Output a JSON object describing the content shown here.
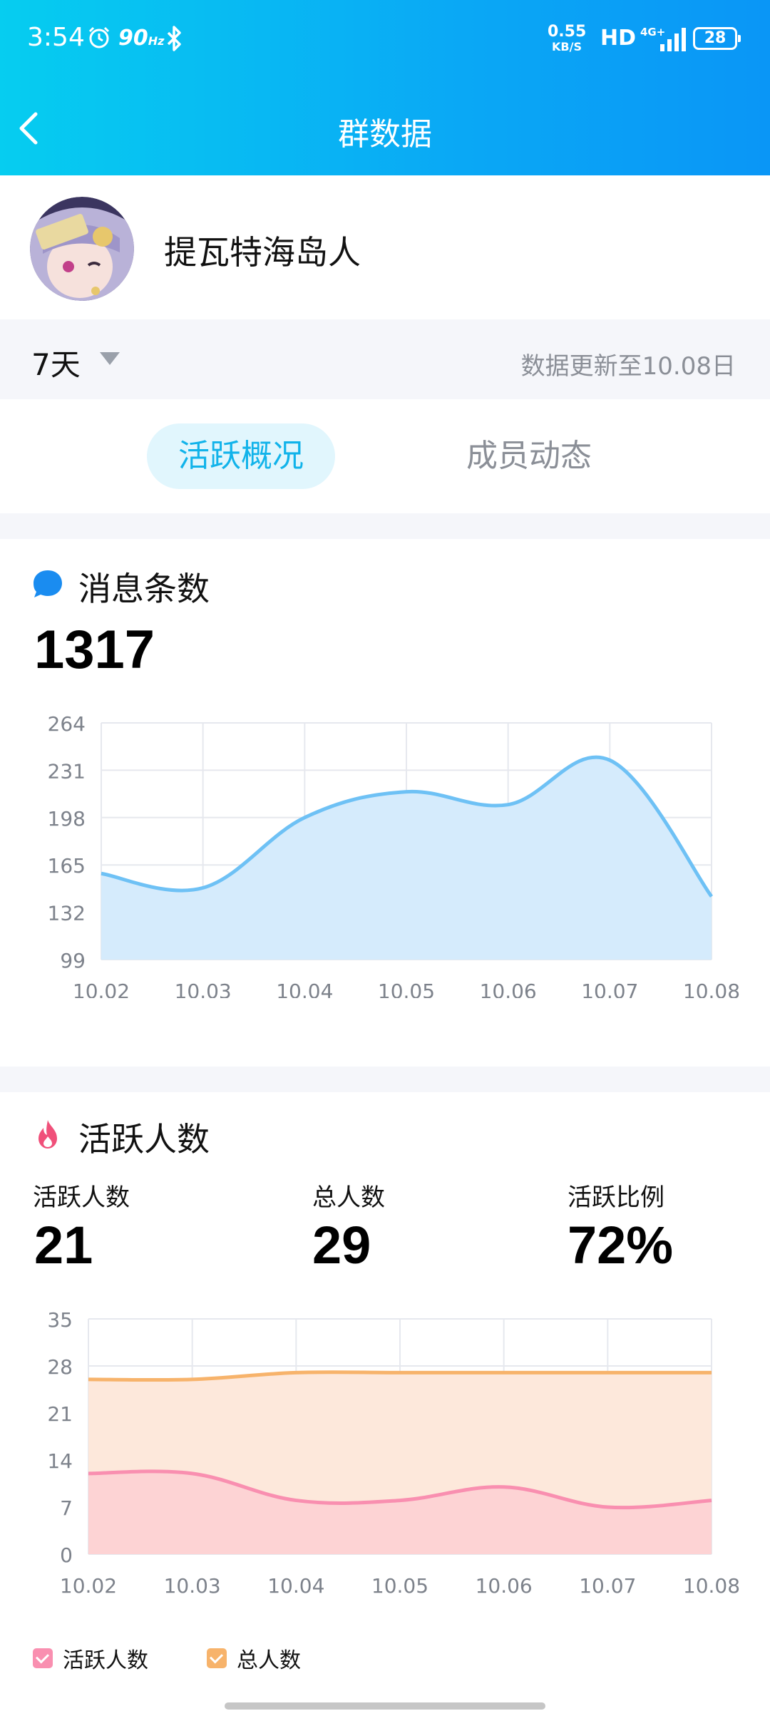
{
  "status_bar": {
    "time": "3:54",
    "refresh_rate": "90",
    "refresh_unit": "Hz",
    "net_speed_value": "0.55",
    "net_speed_unit": "KB/S",
    "hd_label": "HD",
    "network_label": "4G+",
    "battery": "28"
  },
  "nav": {
    "title": "群数据"
  },
  "group": {
    "name": "提瓦特海岛人"
  },
  "filter": {
    "range": "7天",
    "update_text": "数据更新至10.08日"
  },
  "tabs": [
    {
      "label": "活跃概况",
      "active": true
    },
    {
      "label": "成员动态",
      "active": false
    }
  ],
  "messages": {
    "title": "消息条数",
    "total": "1317",
    "icon_color": "#1a8cf0"
  },
  "active": {
    "title": "活跃人数",
    "stats": [
      {
        "label": "活跃人数",
        "value": "21"
      },
      {
        "label": "总人数",
        "value": "29"
      },
      {
        "label": "活跃比例",
        "value": "72%"
      }
    ],
    "icon_color": "#f0507a"
  },
  "chart_data": [
    {
      "type": "area",
      "x": [
        "10.02",
        "10.03",
        "10.04",
        "10.05",
        "10.06",
        "10.07",
        "10.08"
      ],
      "y_ticks": [
        99,
        132,
        165,
        198,
        231,
        264
      ],
      "ylim": [
        99,
        264
      ],
      "grid": true,
      "series": [
        {
          "values": [
            159,
            149,
            198,
            216,
            207,
            238,
            143
          ],
          "color": "#6ec1f5"
        }
      ]
    },
    {
      "type": "area",
      "x": [
        "10.02",
        "10.03",
        "10.04",
        "10.05",
        "10.06",
        "10.07",
        "10.08"
      ],
      "y_ticks": [
        0,
        7,
        14,
        21,
        28,
        35
      ],
      "ylim": [
        0,
        35
      ],
      "grid": true,
      "legend_position": "bottom-left",
      "series": [
        {
          "name": "活跃人数",
          "values": [
            12,
            12,
            8,
            8,
            10,
            7,
            8
          ],
          "color": "#f98fb0"
        },
        {
          "name": "总人数",
          "values": [
            26,
            26,
            27,
            27,
            27,
            27,
            27
          ],
          "color": "#f7b36b"
        }
      ]
    }
  ]
}
